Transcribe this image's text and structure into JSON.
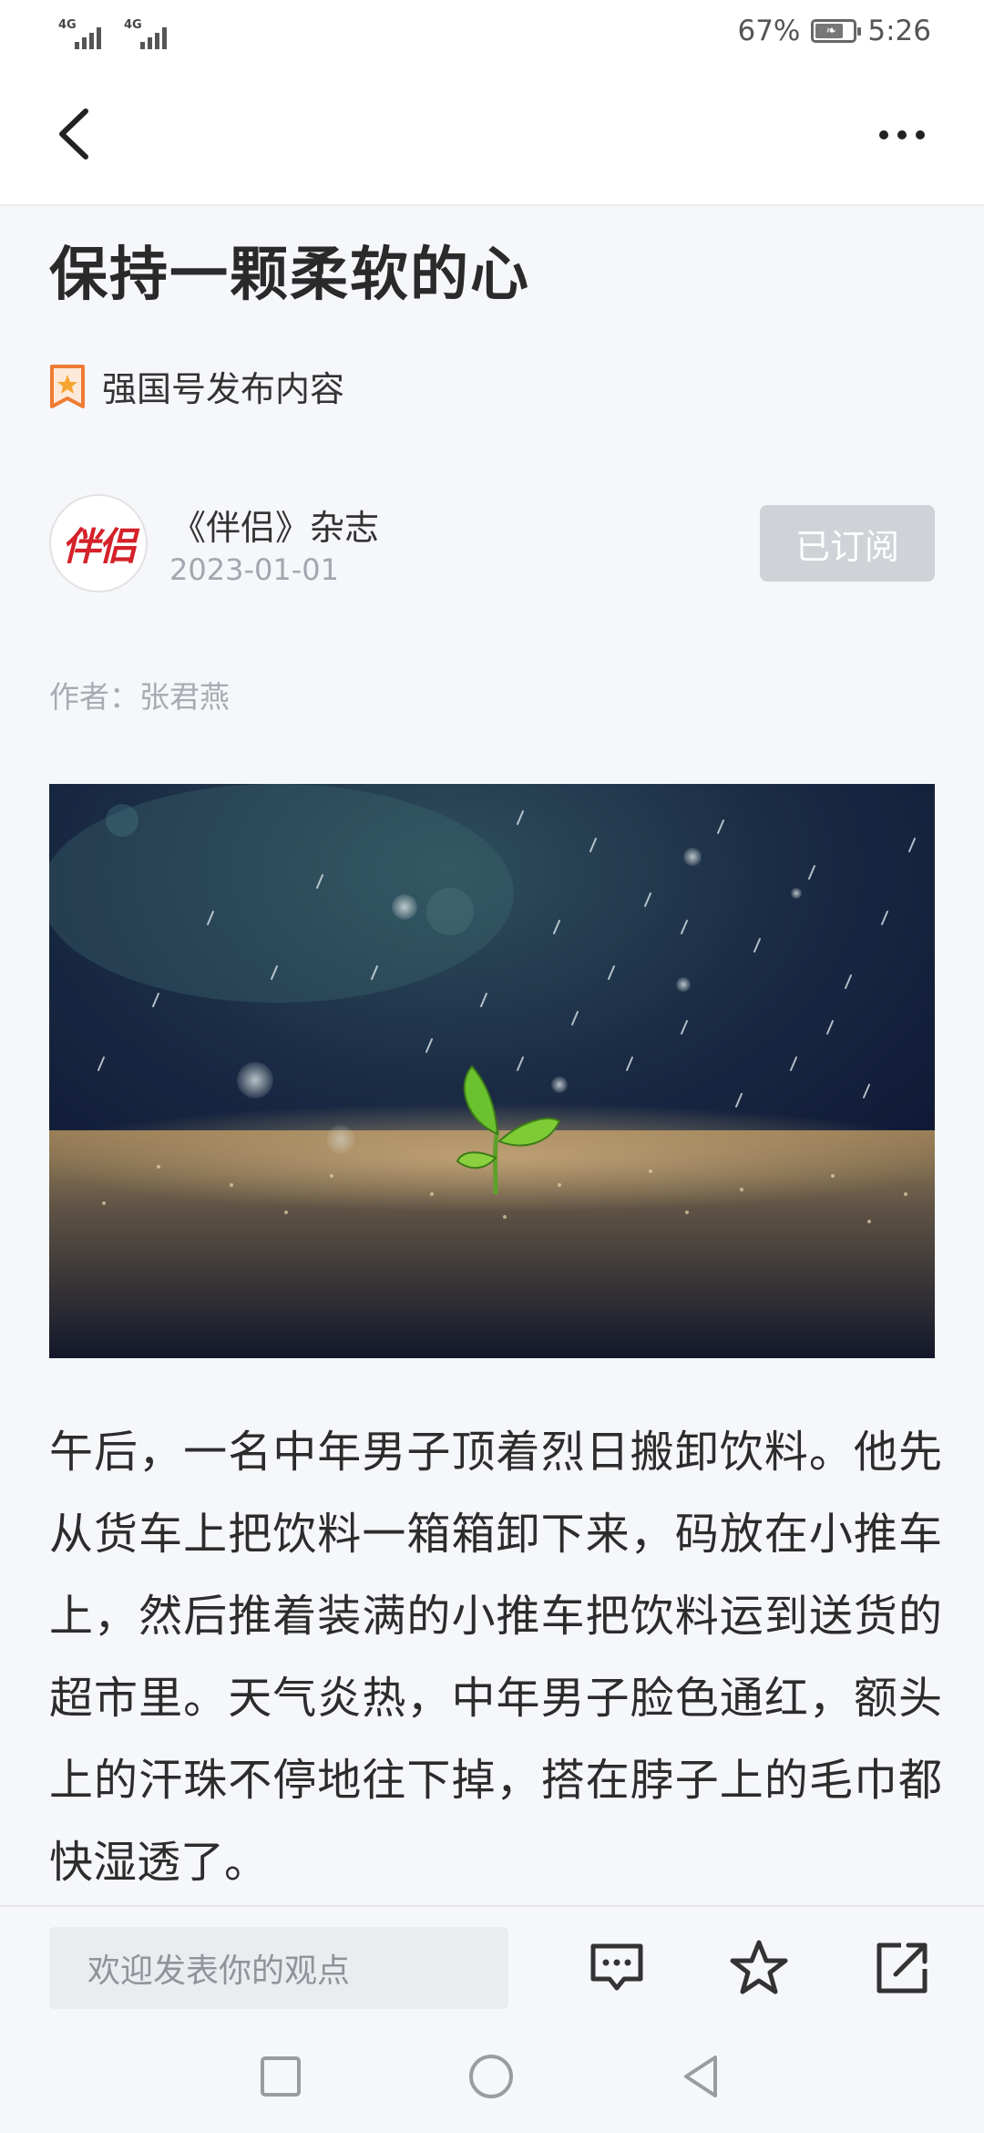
{
  "status_bar": {
    "network_1": "4G",
    "network_2": "4G",
    "battery_percent": "67%",
    "battery_level": 0.67,
    "time": "5:26"
  },
  "nav": {
    "back_icon": "chevron-left-icon",
    "more_icon": "more-horizontal-icon"
  },
  "article": {
    "title": "保持一颗柔软的心",
    "source_label": "强国号发布内容",
    "publisher": {
      "logo_text": "伴侣",
      "name": "《伴侣》杂志",
      "date": "2023-01-01",
      "subscribe_label": "已订阅"
    },
    "author_line": "作者：张君燕",
    "body": "午后，一名中年男子顶着烈日搬卸饮料。他先从货车上把饮料一箱箱卸下来，码放在小推车上，然后推着装满的小推车把饮料运到送货的超市里。天气炎热，中年男子脸色通红，额头上的汗珠不停地往下掉，搭在脖子上的毛巾都快湿透了。"
  },
  "action_bar": {
    "comment_placeholder": "欢迎发表你的观点",
    "icons": [
      "comment-icon",
      "star-icon",
      "share-icon"
    ]
  },
  "system_nav": {
    "icons": [
      "square-icon",
      "circle-icon",
      "triangle-back-icon"
    ]
  },
  "colors": {
    "accent_red": "#d4212a",
    "subscribed_button": "#cfd2d7",
    "background": "#f6f7fa"
  }
}
